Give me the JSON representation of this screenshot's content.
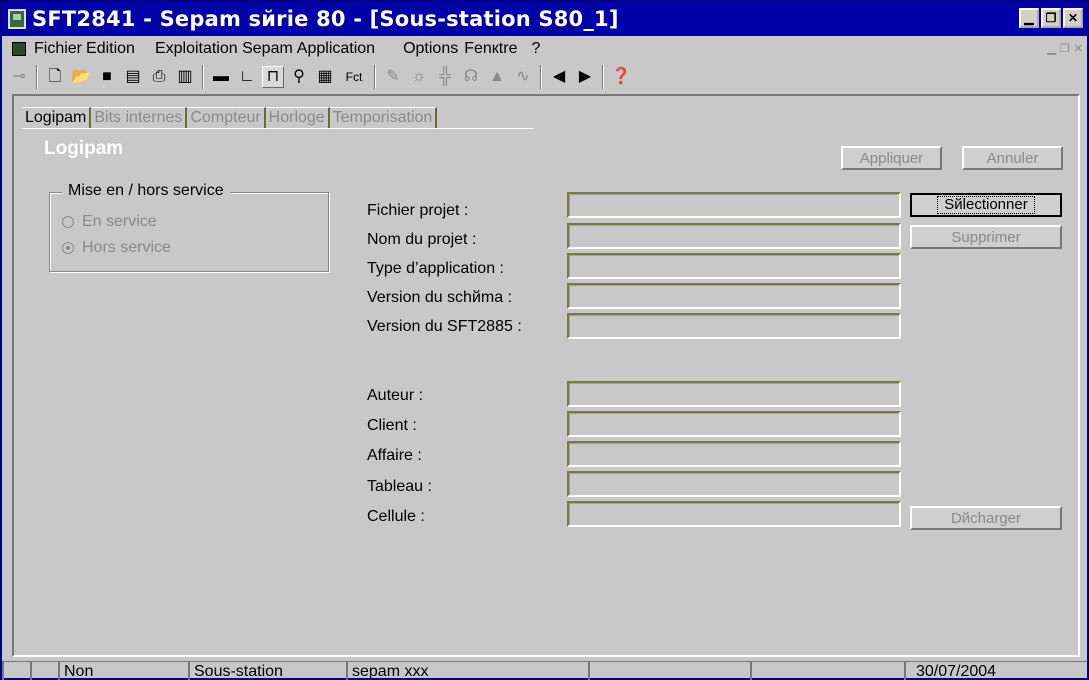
{
  "window": {
    "title": "SFT2841 - Sepam sйrie 80 - [Sous-station S80_1]"
  },
  "menu": {
    "items": [
      "Fichier",
      "Edition",
      "Exploitation Sepam",
      "Application",
      "Options",
      "Fenкtre",
      "?"
    ]
  },
  "toolbar": {
    "fct_label": "Fct"
  },
  "tabs": [
    "Logipam",
    "Bits internes",
    "Compteur",
    "Horloge",
    "Temporisation"
  ],
  "panel": {
    "title": "Logipam",
    "apply_label": "Appliquer",
    "cancel_label": "Annuler",
    "group_title": "Mise en / hors service",
    "radio_in_service": "En service",
    "radio_out_service": "Hors service",
    "radio_selected": "Hors service",
    "select_label": "Sйlectionner",
    "delete_label": "Supprimer",
    "download_label": "Dйcharger"
  },
  "form": {
    "project_file": "Fichier projet :",
    "project_name": "Nom du projet :",
    "app_type": "Type d’application :",
    "schema_version": "Version du schйma :",
    "sft_version": "Version du SFT2885 :",
    "author": "Auteur :",
    "client": "Client :",
    "affaire": "Affaire :",
    "tableau": "Tableau :",
    "cellule": "Cellule :"
  },
  "status": {
    "mode": "Non",
    "station": "Sous-station",
    "device": "sepam xxx",
    "date": "30/07/2004"
  }
}
